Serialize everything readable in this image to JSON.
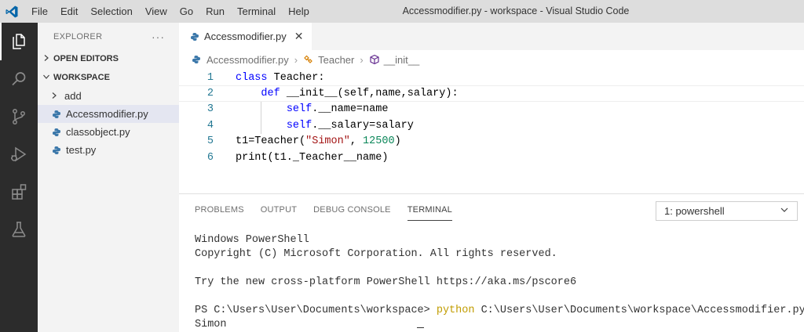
{
  "menu": [
    "File",
    "Edit",
    "Selection",
    "View",
    "Go",
    "Run",
    "Terminal",
    "Help"
  ],
  "window_title": "Accessmodifier.py - workspace - Visual Studio Code",
  "activity_bar": [
    "explorer-icon",
    "search-icon",
    "source-control-icon",
    "run-debug-icon",
    "extensions-icon",
    "testing-icon"
  ],
  "sidebar": {
    "title": "EXPLORER",
    "more": "···",
    "open_editors": "OPEN EDITORS",
    "workspace": "WORKSPACE",
    "items": [
      {
        "label": "add",
        "type": "folder"
      },
      {
        "label": "Accessmodifier.py",
        "type": "python"
      },
      {
        "label": "classobject.py",
        "type": "python"
      },
      {
        "label": "test.py",
        "type": "python"
      }
    ]
  },
  "tab": {
    "label": "Accessmodifier.py",
    "close": "✕"
  },
  "breadcrumb": {
    "file": "Accessmodifier.py",
    "class": "Teacher",
    "method": "__init__"
  },
  "code": {
    "line_numbers": [
      "1",
      "2",
      "3",
      "4",
      "5",
      "6"
    ],
    "l1": {
      "kw": "class",
      "rest": " Teacher:"
    },
    "l2": {
      "indent": "    ",
      "kw": "def",
      "rest": " __init__(self,name,salary):"
    },
    "l3": {
      "indent": "        ",
      "self": "self",
      "rest": ".__name=name"
    },
    "l4": {
      "indent": "        ",
      "self": "self",
      "rest": ".__salary=salary"
    },
    "l5": {
      "a": "t1=Teacher(",
      "str": "\"Simon\"",
      "b": ", ",
      "num": "12500",
      "c": ")"
    },
    "l6": "print(t1._Teacher__name)"
  },
  "panel": {
    "tabs": [
      "PROBLEMS",
      "OUTPUT",
      "DEBUG CONSOLE",
      "TERMINAL"
    ],
    "active_tab": "TERMINAL",
    "terminal_select": "1: powershell",
    "terminal": {
      "l1": "Windows PowerShell",
      "l2": "Copyright (C) Microsoft Corporation. All rights reserved.",
      "l3": "",
      "l4": "Try the new cross-platform PowerShell https://aka.ms/pscore6",
      "l5": "",
      "prompt": "PS C:\\Users\\User\\Documents\\workspace> ",
      "cmd": "python",
      "args": " C:\\Users\\User\\Documents\\workspace\\Accessmodifier.py",
      "output": "Simon"
    }
  },
  "colors": {
    "accent_vscode": "#0065a9",
    "keyword": "#0000ff",
    "string": "#a31515",
    "number": "#098658",
    "python_icon": "#3c78aa",
    "cmd_yellow": "#c19c00"
  }
}
